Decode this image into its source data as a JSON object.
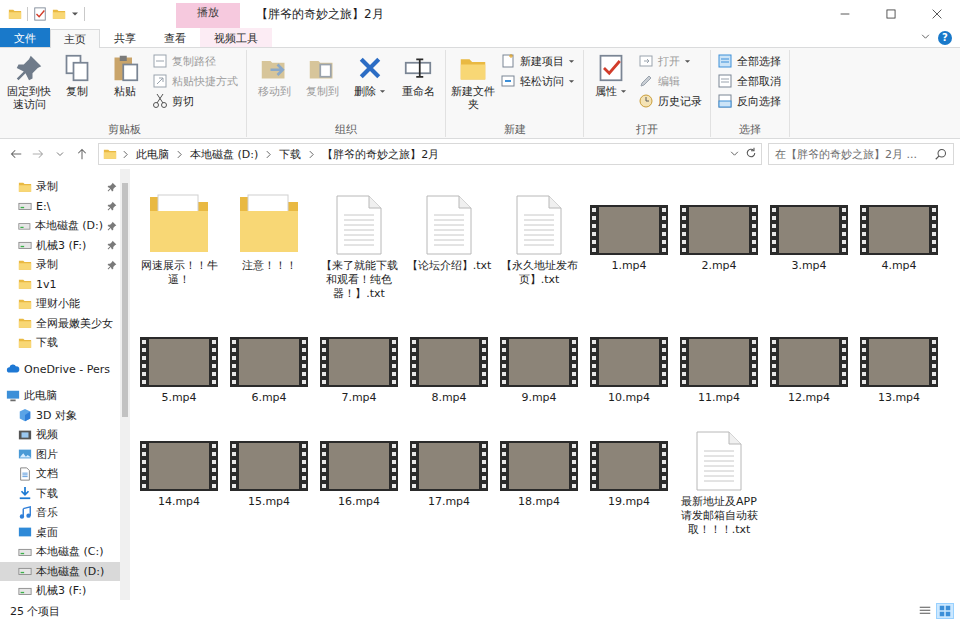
{
  "window": {
    "title": "【胖爷的奇妙之旅】2月",
    "context_tab": "播放"
  },
  "ribbon_tabs": [
    {
      "label": "文件",
      "kind": "file",
      "selected": false
    },
    {
      "label": "主页",
      "kind": "plain",
      "selected": true
    },
    {
      "label": "共享",
      "kind": "plain",
      "selected": false
    },
    {
      "label": "查看",
      "kind": "plain",
      "selected": false
    },
    {
      "label": "视频工具",
      "kind": "context",
      "selected": false
    }
  ],
  "help": "?",
  "ribbon_groups": [
    {
      "label": "剪贴板",
      "buttons": [
        {
          "label": "固定到快速访问",
          "kind": "large",
          "disabled": false,
          "menu": false
        },
        {
          "label": "复制",
          "kind": "large",
          "disabled": false,
          "menu": false
        },
        {
          "label": "粘贴",
          "kind": "large",
          "disabled": false,
          "menu": false
        },
        {
          "label": "复制路径",
          "kind": "small",
          "disabled": true,
          "menu": false
        },
        {
          "label": "粘贴快捷方式",
          "kind": "small",
          "disabled": true,
          "menu": false
        },
        {
          "label": "剪切",
          "kind": "small",
          "disabled": false,
          "menu": false
        }
      ]
    },
    {
      "label": "组织",
      "buttons": [
        {
          "label": "移动到",
          "kind": "large",
          "disabled": true,
          "menu": false
        },
        {
          "label": "复制到",
          "kind": "large",
          "disabled": true,
          "menu": false
        },
        {
          "label": "删除",
          "kind": "large",
          "disabled": false,
          "menu": true
        },
        {
          "label": "重命名",
          "kind": "large",
          "disabled": false,
          "menu": false
        }
      ]
    },
    {
      "label": "新建",
      "buttons": [
        {
          "label": "新建文件夹",
          "kind": "large",
          "disabled": false,
          "menu": false
        },
        {
          "label": "新建项目",
          "kind": "small",
          "disabled": false,
          "menu": true
        },
        {
          "label": "轻松访问",
          "kind": "small",
          "disabled": false,
          "menu": true
        }
      ]
    },
    {
      "label": "打开",
      "buttons": [
        {
          "label": "属性",
          "kind": "large",
          "disabled": false,
          "menu": true
        },
        {
          "label": "打开",
          "kind": "small",
          "disabled": true,
          "menu": true
        },
        {
          "label": "编辑",
          "kind": "small",
          "disabled": true,
          "menu": false
        },
        {
          "label": "历史记录",
          "kind": "small",
          "disabled": false,
          "menu": false
        }
      ]
    },
    {
      "label": "选择",
      "buttons": [
        {
          "label": "全部选择",
          "kind": "small",
          "disabled": false,
          "menu": false
        },
        {
          "label": "全部取消",
          "kind": "small",
          "disabled": false,
          "menu": false
        },
        {
          "label": "反向选择",
          "kind": "small",
          "disabled": false,
          "menu": false
        }
      ]
    }
  ],
  "address": {
    "path": [
      "此电脑",
      "本地磁盘 (D:)",
      "下载",
      "【胖爷的奇妙之旅】2月"
    ]
  },
  "search": {
    "placeholder": "在【胖爷的奇妙之旅】2月 ..."
  },
  "sidebar": {
    "quick_access": [
      {
        "label": "录制",
        "kind": "folder",
        "pinned": true,
        "selected": false
      },
      {
        "label": "E:\\",
        "kind": "drive",
        "pinned": true,
        "selected": false
      },
      {
        "label": "本地磁盘 (D:)",
        "kind": "drive",
        "pinned": true,
        "selected": false
      },
      {
        "label": "机械3 (F:)",
        "kind": "drive",
        "pinned": true,
        "selected": false
      },
      {
        "label": "录制",
        "kind": "folder",
        "pinned": true,
        "selected": false
      },
      {
        "label": "1v1",
        "kind": "folder",
        "pinned": false,
        "selected": false
      },
      {
        "label": "理财小能",
        "kind": "folder",
        "pinned": false,
        "selected": false
      },
      {
        "label": "全网最嫩美少女",
        "kind": "folder",
        "pinned": false,
        "selected": false
      },
      {
        "label": "下载",
        "kind": "folder",
        "pinned": false,
        "selected": false
      }
    ],
    "locations": [
      {
        "label": "OneDrive - Pers",
        "kind": "cloud",
        "selected": false,
        "items": []
      },
      {
        "label": "此电脑",
        "kind": "computer",
        "selected": false,
        "items": [
          {
            "label": "3D 对象",
            "kind": "objects",
            "selected": false
          },
          {
            "label": "视频",
            "kind": "videos",
            "selected": false
          },
          {
            "label": "图片",
            "kind": "pictures",
            "selected": false
          },
          {
            "label": "文档",
            "kind": "documents",
            "selected": false
          },
          {
            "label": "下载",
            "kind": "downloads",
            "selected": false
          },
          {
            "label": "音乐",
            "kind": "music",
            "selected": false
          },
          {
            "label": "桌面",
            "kind": "desktop",
            "selected": false
          },
          {
            "label": "本地磁盘 (C:)",
            "kind": "drive",
            "selected": false
          },
          {
            "label": "本地磁盘 (D:)",
            "kind": "drive",
            "selected": true
          },
          {
            "label": "机械3 (F:)",
            "kind": "drive",
            "selected": false
          }
        ]
      }
    ]
  },
  "files": [
    {
      "name": "网速展示！！牛逼！",
      "kind": "folder",
      "selected": false
    },
    {
      "name": "注意！！！",
      "kind": "folder",
      "selected": false
    },
    {
      "name": "【来了就能下载和观看！纯色器！】.txt",
      "kind": "text",
      "selected": false
    },
    {
      "name": "【论坛介绍】.txt",
      "kind": "text",
      "selected": false
    },
    {
      "name": "【永久地址发布页】.txt",
      "kind": "text",
      "selected": false
    },
    {
      "name": "1.mp4",
      "kind": "video",
      "selected": false
    },
    {
      "name": "2.mp4",
      "kind": "video",
      "selected": false
    },
    {
      "name": "3.mp4",
      "kind": "video",
      "selected": false
    },
    {
      "name": "4.mp4",
      "kind": "video",
      "selected": false
    },
    {
      "name": "5.mp4",
      "kind": "video",
      "selected": false
    },
    {
      "name": "6.mp4",
      "kind": "video",
      "selected": false
    },
    {
      "name": "7.mp4",
      "kind": "video",
      "selected": false
    },
    {
      "name": "8.mp4",
      "kind": "video",
      "selected": false
    },
    {
      "name": "9.mp4",
      "kind": "video",
      "selected": false
    },
    {
      "name": "10.mp4",
      "kind": "video",
      "selected": false
    },
    {
      "name": "11.mp4",
      "kind": "video",
      "selected": false
    },
    {
      "name": "12.mp4",
      "kind": "video",
      "selected": false
    },
    {
      "name": "13.mp4",
      "kind": "video",
      "selected": false
    },
    {
      "name": "14.mp4",
      "kind": "video",
      "selected": false
    },
    {
      "name": "15.mp4",
      "kind": "video",
      "selected": false
    },
    {
      "name": "16.mp4",
      "kind": "video",
      "selected": false
    },
    {
      "name": "17.mp4",
      "kind": "video",
      "selected": false
    },
    {
      "name": "18.mp4",
      "kind": "video",
      "selected": false
    },
    {
      "name": "19.mp4",
      "kind": "video",
      "selected": false
    },
    {
      "name": "最新地址及APP请发邮箱自动获取！！！.txt",
      "kind": "text",
      "selected": false
    }
  ],
  "status_bar": {
    "count": "25 个项目",
    "views": [
      {
        "kind": "details",
        "selected": false
      },
      {
        "kind": "icons",
        "selected": true
      }
    ]
  }
}
